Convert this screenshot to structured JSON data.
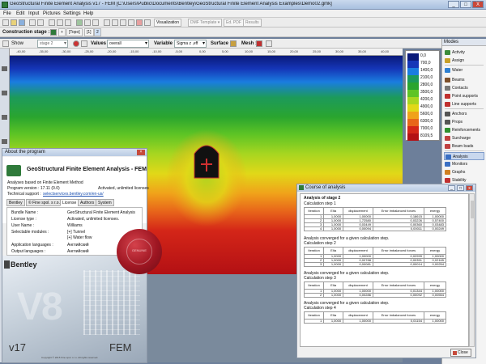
{
  "window": {
    "title": "GeoStructural Finite Element Analysis v17 - FEM [C:\\Users\\Public\\Documents\\Bentley\\GeoStructural Finite Element Analysis Examples\\Demo02.gmk]",
    "controls": [
      "_",
      "□",
      "X"
    ]
  },
  "menu": [
    "File",
    "Edit",
    "Input",
    "Pictures",
    "Settings",
    "Help"
  ],
  "toolbar1": {
    "visualization": "Visualization",
    "template": "DMF Template ▾",
    "pdf": "Ed. PDF",
    "results": "Results"
  },
  "toolbar2": {
    "stage_label": "Construction stage :",
    "topo": "[Topo]",
    "stage_box": "[1]",
    "stage_num": "2"
  },
  "toolbar3": {
    "show_label": "Show",
    "stage_combo": "stage 2",
    "values_label": "Values :",
    "values_combo": "overall",
    "variable_label": "Variable :",
    "variable_combo": "Sigma z ,eff",
    "surface_label": "Surface :",
    "mesh_label": "Mesh :"
  },
  "ruler": [
    "-40,00",
    "-35,00",
    "-30,00",
    "-25,00",
    "-20,00",
    "-15,00",
    "-10,00",
    "-5,00",
    "0,00",
    "5,00",
    "10,00",
    "15,00",
    "20,00",
    "25,00",
    "30,00",
    "35,00",
    "40,00"
  ],
  "legend": {
    "values": [
      "0,0",
      "700,0",
      "1400,0",
      "2100,0",
      "2800,0",
      "3500,0",
      "4200,0",
      "4900,0",
      "5600,0",
      "6300,0",
      "7000,0",
      "8109,5"
    ],
    "colors": [
      "#0a1a7a",
      "#1536b8",
      "#1a7de0",
      "#1c9a5b",
      "#2aa52f",
      "#5ec425",
      "#a8d620",
      "#e1d818",
      "#f0a21a",
      "#e8661a",
      "#d42618",
      "#b31014"
    ]
  },
  "modes": {
    "header": "Modes",
    "items": [
      {
        "label": "Activity",
        "color": "#3b8c3b"
      },
      {
        "label": "Assign",
        "color": "#c7a028"
      },
      {
        "label": "Water",
        "color": "#2d7fd1"
      },
      {
        "label": "Beams",
        "color": "#7d4f2a"
      },
      {
        "label": "Contacts",
        "color": "#777"
      },
      {
        "label": "Point supports",
        "color": "#c03030"
      },
      {
        "label": "Line supports",
        "color": "#c03030"
      },
      {
        "label": "Anchors",
        "color": "#555"
      },
      {
        "label": "Props",
        "color": "#555"
      },
      {
        "label": "Reinforcements",
        "color": "#2f8f2f"
      },
      {
        "label": "Surcharge",
        "color": "#c04040"
      },
      {
        "label": "Beam loads",
        "color": "#c04040"
      },
      {
        "label": "Analysis",
        "color": "#3a6fc3"
      },
      {
        "label": "Monitors",
        "color": "#3a6fc3"
      },
      {
        "label": "Graphs",
        "color": "#d08020"
      },
      {
        "label": "Stability",
        "color": "#c03030"
      }
    ]
  },
  "about": {
    "caption": "About the program",
    "product": "GeoStructural Finite Element Analysis - FEM",
    "line1": "Analyses based on Finite Element Method",
    "version": "Program version : 17.11 (0.0)",
    "status": "Activated, unlimited licenses",
    "support_label": "Technical support :",
    "support_link": "selectservices.bentley.com/en-us/",
    "tabs": [
      "Bentley",
      "© Fine spol. s r.o.",
      "License",
      "Authors",
      "System"
    ],
    "fields": [
      {
        "k": "Bundle Name :",
        "v": "GeoStructural Finite Element Analysis"
      },
      {
        "k": "License type :",
        "v": "Activated, unlimited licenses."
      },
      {
        "k": "User Name :",
        "v": "Williams"
      },
      {
        "k": "Selectable modules :",
        "v": "[+] Tunnel"
      },
      {
        "k": "",
        "v": "[+] Water flow"
      },
      {
        "k": "Application languages :",
        "v": "Английский"
      },
      {
        "k": "Output languages :",
        "v": "Английский"
      }
    ],
    "brand": "Bentley",
    "ver_big": "V8",
    "v17": "v17",
    "fem": "FEM",
    "copyright": "Copyright © 2015 Fine spol. s r.o. All rights reserved.",
    "seal_text": "GENUINE"
  },
  "course": {
    "caption": "Course of analysis",
    "heading": "Analysis of stage 2",
    "blocks": [
      {
        "title": "Calculation step 1",
        "rows": [
          [
            "1",
            "1,0000",
            "1,00000",
            "0,18615",
            "1,00000"
          ],
          [
            "2",
            "1,0000",
            "1,72580",
            "0,03226",
            "0,57400"
          ],
          [
            "3",
            "1,0000",
            "0,03449",
            "0,00360",
            "0,03483"
          ],
          [
            "4",
            "1,0000",
            "0,00094",
            "0,00011",
            "0,00249"
          ]
        ],
        "footer": "Analysis converged for a given calculation step."
      },
      {
        "title": "Calculation step 2",
        "rows": [
          [
            "1",
            "1,0000",
            "1,00000",
            "0,02999",
            "1,00000"
          ],
          [
            "2",
            "1,0000",
            "0,00788",
            "0,00351",
            "0,02165"
          ],
          [
            "3",
            "1,0000",
            "0,00081",
            "0,00014",
            "0,00254"
          ]
        ],
        "footer": "Analysis converged for a given calculation step."
      },
      {
        "title": "Calculation step 3",
        "rows": [
          [
            "1",
            "1,0000",
            "1,00000",
            "0,01344",
            "1,00000"
          ],
          [
            "2",
            "1,0000",
            "0,00286",
            "0,00092",
            "0,00554"
          ]
        ],
        "footer": "Analysis converged for a given calculation step."
      },
      {
        "title": "Calculation step 4",
        "rows": [
          [
            "1",
            "1,0000",
            "1,00000",
            "0,01154",
            "1,00000"
          ]
        ],
        "footer": ""
      }
    ],
    "columns": [
      "Iteration",
      "Elta",
      "displacement",
      "Error imbalanced forces",
      "energy"
    ],
    "close": "Close"
  }
}
